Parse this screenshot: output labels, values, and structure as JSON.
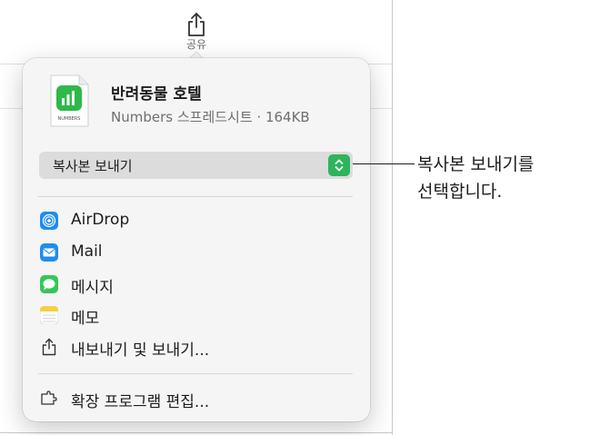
{
  "toolbar": {
    "share_label": "공유"
  },
  "file": {
    "name": "반려동물 호텔",
    "meta": "Numbers 스프레드시트 · 164KB",
    "icon_label": "NUMBERS"
  },
  "send_copy": {
    "selected": "복사본 보내기"
  },
  "share_items": [
    {
      "label": "AirDrop",
      "icon": "airdrop-icon"
    },
    {
      "label": "Mail",
      "icon": "mail-icon"
    },
    {
      "label": "메시지",
      "icon": "messages-icon"
    },
    {
      "label": "메모",
      "icon": "notes-icon"
    },
    {
      "label": "내보내기 및 보내기...",
      "icon": "export-icon"
    }
  ],
  "extensions": {
    "label": "확장 프로그램 편집...",
    "icon": "extensions-icon"
  },
  "callout": {
    "line1": "복사본 보내기를",
    "line2": "선택합니다."
  },
  "colors": {
    "accent_green": "#2eb45b",
    "numbers_green": "#30b84a",
    "mail_blue": "#1e8cf4",
    "messages_green": "#34c759",
    "notes_yellow": "#f7cf46"
  }
}
